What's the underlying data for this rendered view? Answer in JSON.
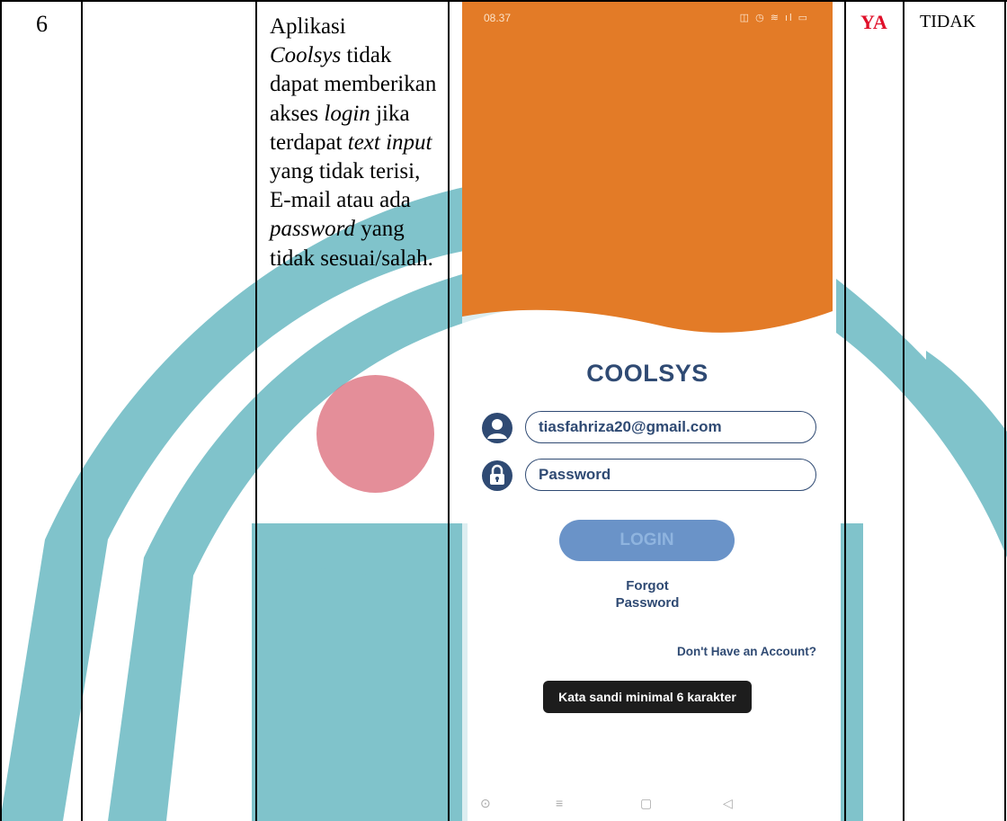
{
  "row": {
    "number": "6",
    "result_yes": "YA",
    "result_no": "TIDAK",
    "description": {
      "p1": "Aplikasi",
      "app_name": "Coolsys",
      "p2": " tidak dapat memberikan akses ",
      "login_word": "login",
      "p3": " jika terdapat ",
      "text_input": "text input",
      "p4": " yang tidak terisi, E-mail atau ada ",
      "password_word": "password",
      "p5": " yang tidak sesuai/salah."
    }
  },
  "phone": {
    "status_time": "08.37",
    "brand": "COOLSYS",
    "email_value": "tiasfahriza20@gmail.com",
    "password_placeholder": "Password",
    "login_label": "LOGIN",
    "forgot_label": "Forgot\nPassword",
    "forgot_line1": "Forgot",
    "forgot_line2": "Password",
    "signup_link": "Don't Have an Account?",
    "toast": "Kata sandi minimal 6 karakter",
    "nav": {
      "icon_circle": "⊙",
      "icon_menu": "≡",
      "icon_square": "▢",
      "icon_back": "◁"
    }
  },
  "colors": {
    "header_orange": "#e37b27",
    "brand_navy": "#2f4a73",
    "login_blue": "#6a93c8",
    "watermark_teal": "#80c3cb",
    "ya_red": "#e0102a"
  }
}
